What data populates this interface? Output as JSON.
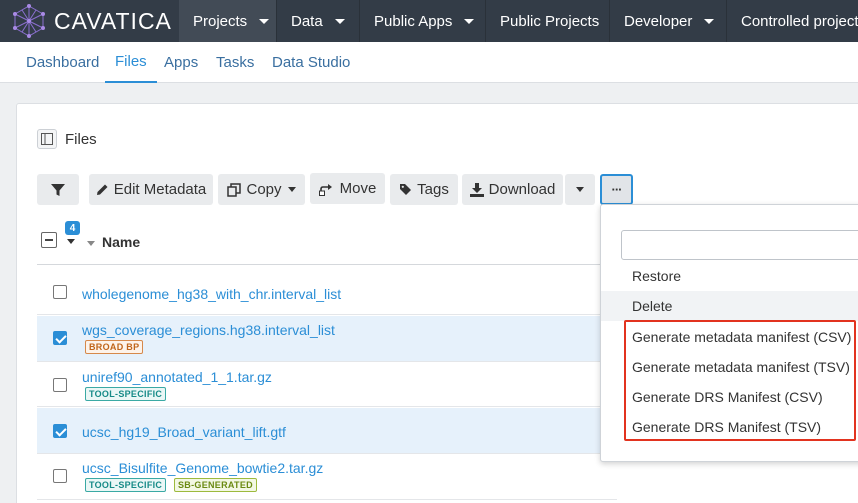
{
  "app": {
    "name": "CAVATICA"
  },
  "topnav": {
    "items": [
      {
        "label": "Projects",
        "has_caret": true,
        "active": true
      },
      {
        "label": "Data",
        "has_caret": true
      },
      {
        "label": "Public Apps",
        "has_caret": true
      },
      {
        "label": "Public Projects",
        "has_caret": false
      },
      {
        "label": "Developer",
        "has_caret": true
      },
      {
        "label": "Controlled projects",
        "has_caret": false
      }
    ]
  },
  "subnav": {
    "tabs": [
      {
        "label": "Dashboard"
      },
      {
        "label": "Files",
        "active": true
      },
      {
        "label": "Apps"
      },
      {
        "label": "Tasks"
      },
      {
        "label": "Data Studio"
      }
    ]
  },
  "files_panel": {
    "title": "Files"
  },
  "toolbar": {
    "filter_icon": "filter-icon",
    "edit_metadata_label": "Edit Metadata",
    "copy_label": "Copy",
    "move_label": "Move",
    "tags_label": "Tags",
    "download_label": "Download",
    "more_label": "···"
  },
  "table": {
    "selected_count": "4",
    "name_header": "Name",
    "rows": [
      {
        "name": "wholegenome_hg38_with_chr.interval_list",
        "checked": false,
        "tags": []
      },
      {
        "name": "wgs_coverage_regions.hg38.interval_list",
        "checked": true,
        "tags": [
          "BROAD BP"
        ]
      },
      {
        "name": "uniref90_annotated_1_1.tar.gz",
        "checked": false,
        "tags": [
          "TOOL-SPECIFIC"
        ]
      },
      {
        "name": "ucsc_hg19_Broad_variant_lift.gtf",
        "checked": true,
        "tags": []
      },
      {
        "name": "ucsc_Bisulfite_Genome_bowtie2.tar.gz",
        "checked": false,
        "tags": [
          "TOOL-SPECIFIC",
          "SB-GENERATED"
        ]
      }
    ]
  },
  "dropdown": {
    "search_placeholder": "",
    "items": [
      {
        "label": "Restore"
      },
      {
        "label": "Delete"
      },
      {
        "label": "Generate metadata manifest (CSV)"
      },
      {
        "label": "Generate metadata manifest (TSV)"
      },
      {
        "label": "Generate DRS Manifest (CSV)"
      },
      {
        "label": "Generate DRS Manifest (TSV)"
      }
    ]
  },
  "colors": {
    "navbar": "#333c47",
    "accent": "#2b8ed6",
    "highlight_box": "#e2331f"
  }
}
